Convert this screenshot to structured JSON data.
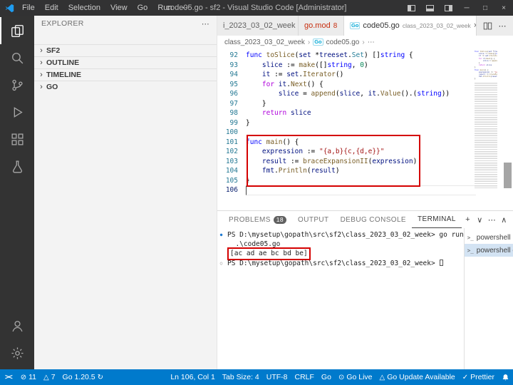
{
  "title_bar": {
    "title": "code05.go - sf2 - Visual Studio Code [Administrator]",
    "menus": [
      "File",
      "Edit",
      "Selection",
      "View",
      "Go",
      "Run",
      "⋯"
    ],
    "window_controls": [
      "─",
      "□",
      "×"
    ]
  },
  "activity_bar": {
    "items": [
      "explorer",
      "search",
      "source-control",
      "run-debug",
      "extensions",
      "testing"
    ],
    "bottom": [
      "account",
      "settings"
    ]
  },
  "sidebar": {
    "header": "EXPLORER",
    "header_more": "⋯",
    "sections": [
      "SF2",
      "OUTLINE",
      "TIMELINE",
      "GO"
    ]
  },
  "editor": {
    "go_icon_text": "Go",
    "more_icon": "⋯",
    "tabs": [
      {
        "label": "i_2023_03_02_week",
        "kind": "plain",
        "active": false
      },
      {
        "label": "go.mod",
        "kind": "error",
        "badge": "8",
        "active": false
      },
      {
        "label": "code05.go",
        "kind": "go",
        "description": "class_2023_03_02_week",
        "close": "×",
        "active": true
      }
    ],
    "breadcrumb": [
      "class_2023_03_02_week",
      "code05.go",
      "⋯"
    ],
    "lines": [
      {
        "n": "92",
        "t": [
          [
            "func ",
            "kw"
          ],
          [
            "toSlice",
            "fn"
          ],
          [
            "(",
            "pl"
          ],
          [
            "set",
            "vr"
          ],
          [
            " *",
            "pl"
          ],
          [
            "treeset",
            "vr"
          ],
          [
            ".",
            "pl"
          ],
          [
            "Set",
            "ty"
          ],
          [
            ") []",
            "pl"
          ],
          [
            "string",
            "kw"
          ],
          [
            " {",
            "pl"
          ]
        ]
      },
      {
        "n": "93",
        "t": [
          [
            "    ",
            "pl"
          ],
          [
            "slice",
            "vr"
          ],
          [
            " := ",
            "pl"
          ],
          [
            "make",
            "fn"
          ],
          [
            "([]",
            "pl"
          ],
          [
            "string",
            "kw"
          ],
          [
            ", ",
            "pl"
          ],
          [
            "0",
            "nm"
          ],
          [
            ")",
            "pl"
          ]
        ]
      },
      {
        "n": "94",
        "t": [
          [
            "    ",
            "pl"
          ],
          [
            "it",
            "vr"
          ],
          [
            " := ",
            "pl"
          ],
          [
            "set",
            "vr"
          ],
          [
            ".",
            "pl"
          ],
          [
            "Iterator",
            "fn"
          ],
          [
            "()",
            "pl"
          ]
        ]
      },
      {
        "n": "95",
        "t": [
          [
            "    ",
            "pl"
          ],
          [
            "for",
            "ct"
          ],
          [
            " ",
            "pl"
          ],
          [
            "it",
            "vr"
          ],
          [
            ".",
            "pl"
          ],
          [
            "Next",
            "fn"
          ],
          [
            "() {",
            "pl"
          ]
        ]
      },
      {
        "n": "96",
        "t": [
          [
            "        ",
            "pl"
          ],
          [
            "slice",
            "vr"
          ],
          [
            " = ",
            "pl"
          ],
          [
            "append",
            "fn"
          ],
          [
            "(",
            "pl"
          ],
          [
            "slice",
            "vr"
          ],
          [
            ", ",
            "pl"
          ],
          [
            "it",
            "vr"
          ],
          [
            ".",
            "pl"
          ],
          [
            "Value",
            "fn"
          ],
          [
            "().(",
            "pl"
          ],
          [
            "string",
            "kw"
          ],
          [
            "))",
            "pl"
          ]
        ]
      },
      {
        "n": "97",
        "t": [
          [
            "    }",
            "pl"
          ]
        ]
      },
      {
        "n": "98",
        "t": [
          [
            "    ",
            "pl"
          ],
          [
            "return",
            "ct"
          ],
          [
            " ",
            "pl"
          ],
          [
            "slice",
            "vr"
          ]
        ]
      },
      {
        "n": "99",
        "t": [
          [
            "}",
            "pl"
          ]
        ]
      },
      {
        "n": "100",
        "t": []
      },
      {
        "n": "101",
        "t": [
          [
            "func ",
            "kw"
          ],
          [
            "main",
            "fn"
          ],
          [
            "() {",
            "pl"
          ]
        ]
      },
      {
        "n": "102",
        "t": [
          [
            "    ",
            "pl"
          ],
          [
            "expression",
            "vr"
          ],
          [
            " := ",
            "pl"
          ],
          [
            "\"{a,b}{c,{d,e}}\"",
            "st"
          ]
        ]
      },
      {
        "n": "103",
        "t": [
          [
            "    ",
            "pl"
          ],
          [
            "result",
            "vr"
          ],
          [
            " := ",
            "pl"
          ],
          [
            "braceExpansionII",
            "fn"
          ],
          [
            "(",
            "pl"
          ],
          [
            "expression",
            "vr"
          ],
          [
            ")",
            "pl"
          ]
        ]
      },
      {
        "n": "104",
        "t": [
          [
            "    ",
            "pl"
          ],
          [
            "fmt",
            "vr"
          ],
          [
            ".",
            "pl"
          ],
          [
            "Println",
            "fn"
          ],
          [
            "(",
            "pl"
          ],
          [
            "result",
            "vr"
          ],
          [
            ")",
            "pl"
          ]
        ]
      },
      {
        "n": "105",
        "t": [
          [
            "}",
            "pl"
          ]
        ]
      },
      {
        "n": "106",
        "t": [],
        "current": true
      }
    ]
  },
  "panel": {
    "tabs": [
      {
        "label": "PROBLEMS",
        "badge": "18",
        "active": false
      },
      {
        "label": "OUTPUT",
        "active": false
      },
      {
        "label": "DEBUG CONSOLE",
        "active": false
      },
      {
        "label": "TERMINAL",
        "active": true
      }
    ],
    "actions": [
      "+",
      "∨",
      "⋯",
      "∧",
      "×"
    ],
    "terminal_lines": [
      {
        "marker": "filled",
        "text": "PS D:\\mysetup\\gopath\\src\\sf2\\class_2023_03_02_week> go run"
      },
      {
        "text": "  .\\code05.go"
      },
      {
        "text": "[ac ad ae bc bd be]",
        "boxed": true
      },
      {
        "marker": "hollow",
        "text": "PS D:\\mysetup\\gopath\\src\\sf2\\class_2023_03_02_week> ",
        "cursor": true
      }
    ],
    "terminal_list": [
      {
        "label": "powershell",
        "selected": false
      },
      {
        "label": "powershell cla…",
        "selected": true
      }
    ]
  },
  "status_bar": {
    "left": [
      {
        "name": "remote-indicator",
        "icon": "remote"
      },
      {
        "name": "errors-count",
        "icon": "error",
        "label": "11"
      },
      {
        "name": "warnings-count",
        "icon": "warning",
        "label": "7"
      },
      {
        "name": "go-version",
        "label": "Go 1.20.5",
        "trailing_icon": "sync"
      }
    ],
    "right": [
      {
        "name": "cursor-position",
        "label": "Ln 106, Col 1"
      },
      {
        "name": "tab-size",
        "label": "Tab Size: 4"
      },
      {
        "name": "encoding",
        "label": "UTF-8"
      },
      {
        "name": "eol",
        "label": "CRLF"
      },
      {
        "name": "language-mode",
        "label": "Go"
      },
      {
        "name": "go-live",
        "icon": "broadcast",
        "label": "Go Live"
      },
      {
        "name": "go-update",
        "icon": "warning",
        "label": "Go Update Available"
      },
      {
        "name": "prettier",
        "icon": "check",
        "label": "Prettier"
      },
      {
        "name": "notifications",
        "icon": "bell"
      }
    ]
  }
}
